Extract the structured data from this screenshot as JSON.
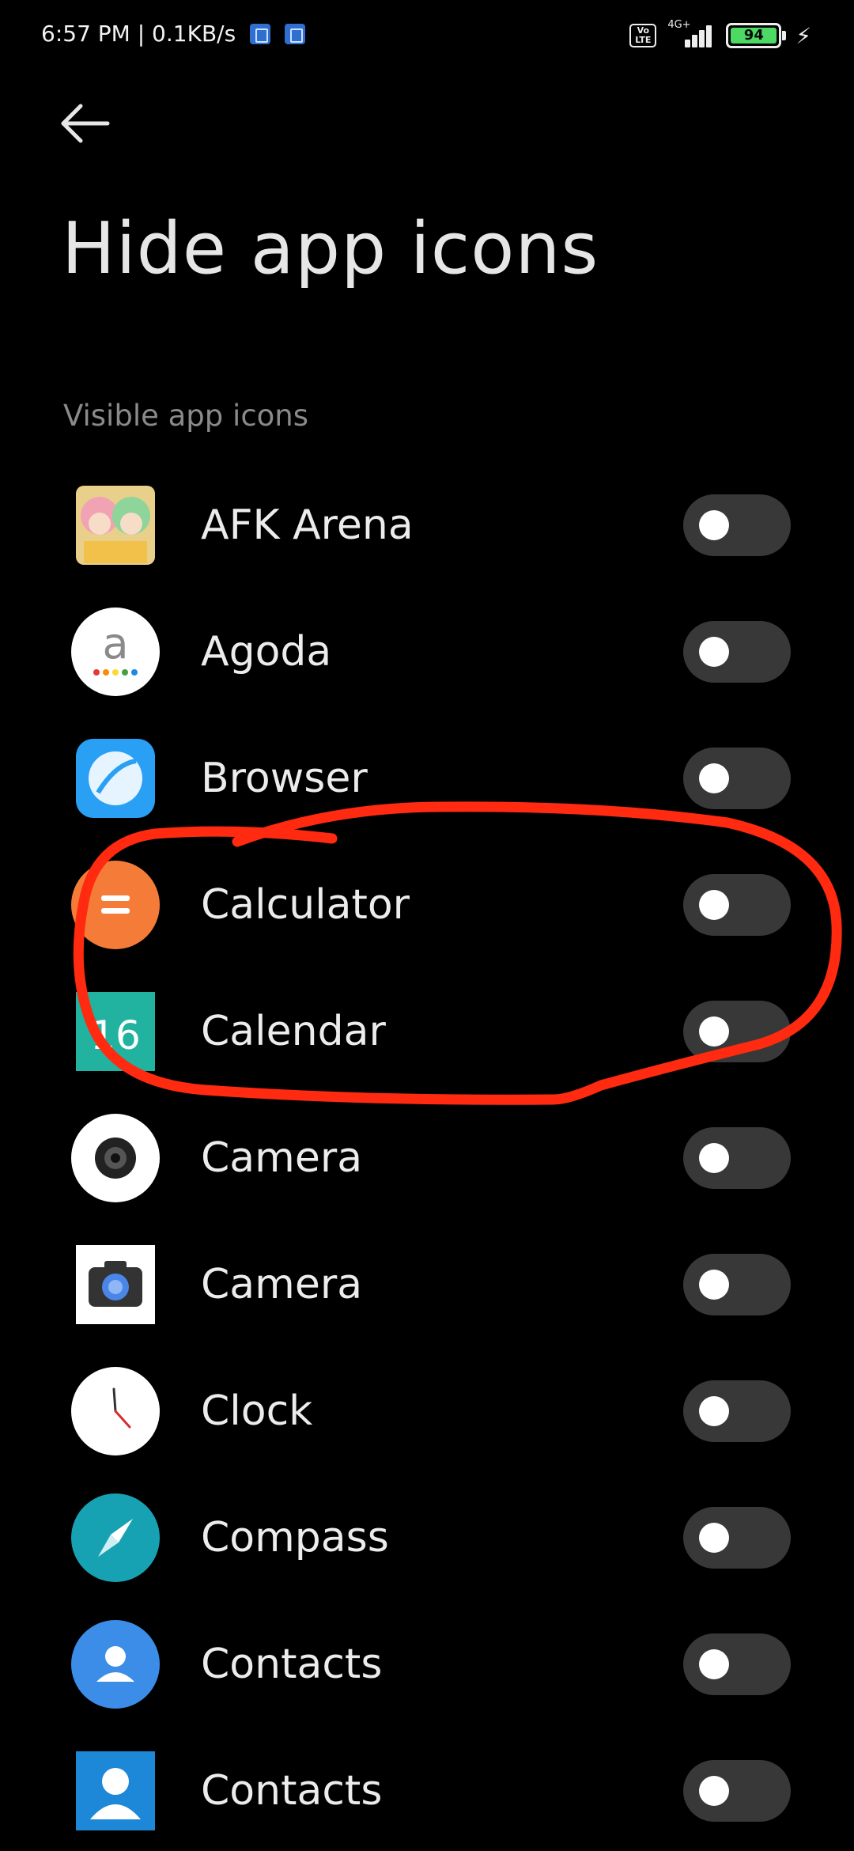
{
  "status_bar": {
    "time_speed": "6:57 PM | 0.1KB/s",
    "volte": "Vo LTE",
    "network": "4G+",
    "battery": "94",
    "battery_color": "#4cd964"
  },
  "header": {
    "back_icon": "arrow-left-icon",
    "title": "Hide app icons"
  },
  "section_label": "Visible app icons",
  "apps": [
    {
      "name": "AFK Arena",
      "icon": "afk-arena-icon",
      "enabled": false
    },
    {
      "name": "Agoda",
      "icon": "agoda-icon",
      "enabled": false
    },
    {
      "name": "Browser",
      "icon": "browser-icon",
      "enabled": false
    },
    {
      "name": "Calculator",
      "icon": "calculator-icon",
      "enabled": false
    },
    {
      "name": "Calendar",
      "icon": "calendar-icon",
      "icon_text": "16",
      "enabled": false
    },
    {
      "name": "Camera",
      "icon": "camera-icon",
      "enabled": false
    },
    {
      "name": "Camera",
      "icon": "google-camera-icon",
      "enabled": false
    },
    {
      "name": "Clock",
      "icon": "clock-icon",
      "enabled": false
    },
    {
      "name": "Compass",
      "icon": "compass-icon",
      "enabled": false
    },
    {
      "name": "Contacts",
      "icon": "contacts-icon",
      "enabled": false
    },
    {
      "name": "Contacts",
      "icon": "contacts-square-icon",
      "enabled": false
    }
  ],
  "annotation": {
    "type": "hand-drawn-circle",
    "color": "#ff2a10",
    "encloses": [
      "Calculator",
      "Calendar"
    ]
  },
  "toggle_colors": {
    "track": "#383838",
    "knob": "#ffffff"
  }
}
